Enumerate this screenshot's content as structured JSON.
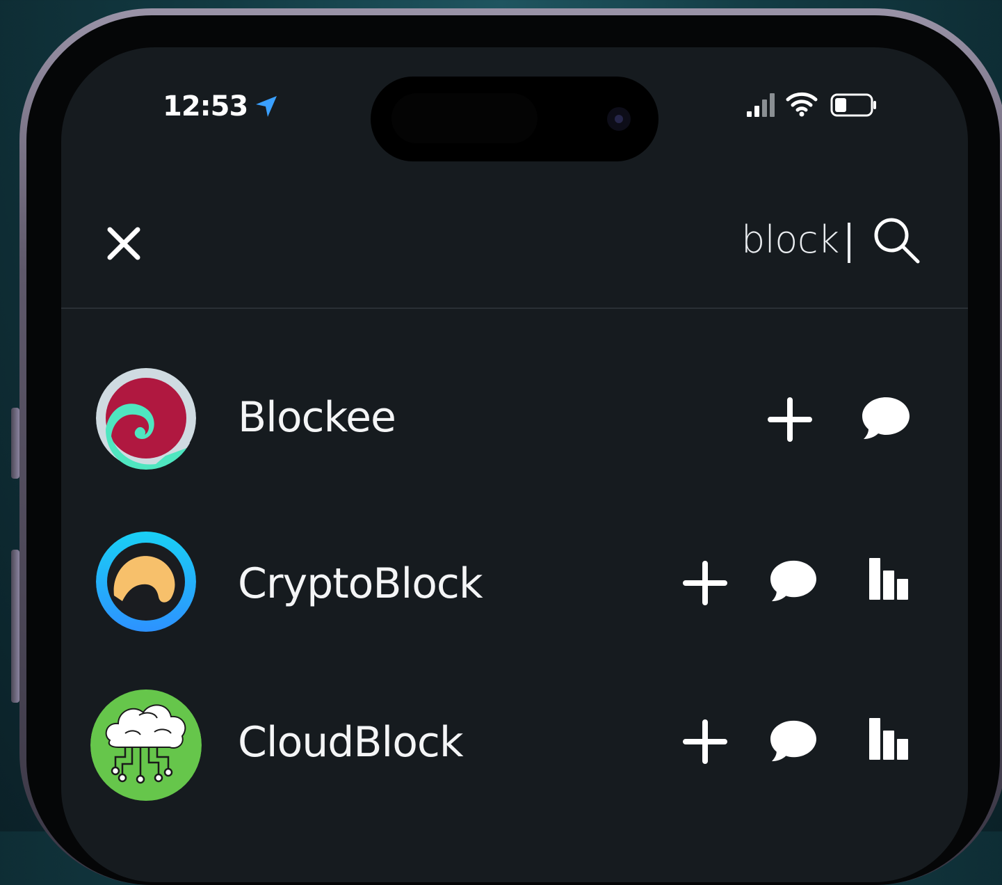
{
  "status_bar": {
    "time": "12:53",
    "icons": [
      "location-arrow-icon",
      "cellular-signal-icon",
      "wifi-icon",
      "battery-icon"
    ]
  },
  "search": {
    "query": "block",
    "close_icon": "close-icon",
    "search_icon": "search-icon"
  },
  "colors": {
    "background": "#161b1f",
    "text": "#f4f5f6",
    "location_arrow": "#3aa0ff"
  },
  "results": [
    {
      "name": "Blockee",
      "actions": [
        "plus-icon",
        "chat-bubble-icon"
      ]
    },
    {
      "name": "CryptoBlock",
      "actions": [
        "plus-icon",
        "chat-bubble-icon",
        "bar-chart-icon"
      ]
    },
    {
      "name": "CloudBlock",
      "actions": [
        "plus-icon",
        "chat-bubble-icon",
        "bar-chart-icon"
      ]
    }
  ]
}
